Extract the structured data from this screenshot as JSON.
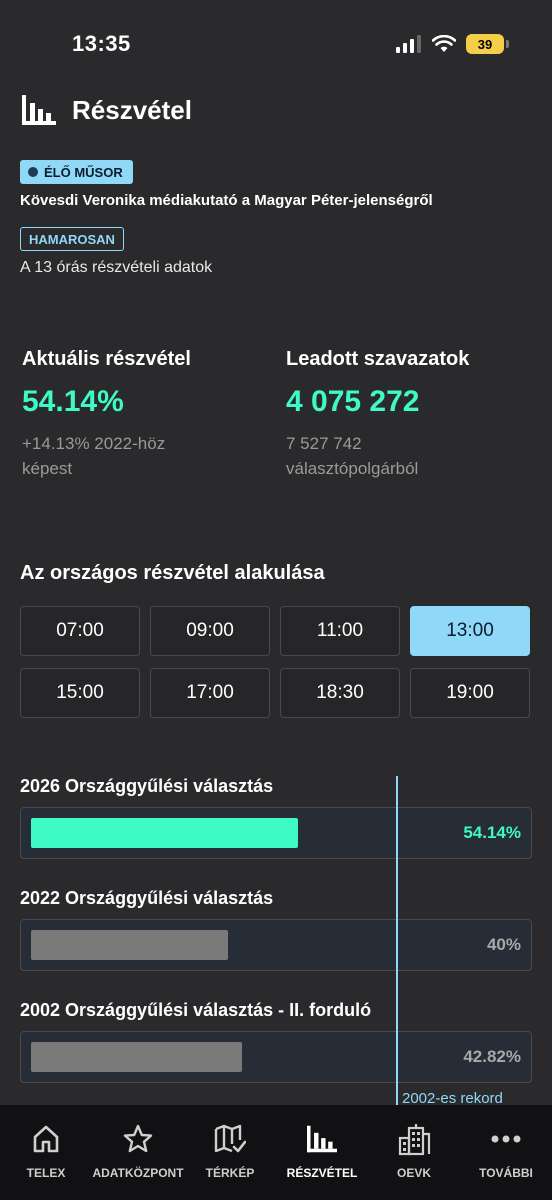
{
  "status_bar": {
    "time": "13:35",
    "battery": "39"
  },
  "header": {
    "title": "Részvétel",
    "icon": "bar-chart-icon"
  },
  "live": {
    "badge": "ÉLŐ MŰSOR",
    "title": "Kövesdi Veronika médiakutató a Magyar Péter-jelenségről",
    "soon_badge": "HAMAROSAN",
    "soon_text": "A 13 órás részvételi adatok"
  },
  "stats": {
    "turnout": {
      "label": "Aktuális részvétel",
      "value": "54.14%",
      "sub1": "+14.13% 2022-höz",
      "sub2": "képest"
    },
    "votes": {
      "label": "Leadott szavazatok",
      "value": "4 075 272",
      "sub1": "7 527 742",
      "sub2": "választópolgárból"
    }
  },
  "section_title": "Az országos részvétel alakulása",
  "times": [
    "07:00",
    "09:00",
    "11:00",
    "13:00",
    "15:00",
    "17:00",
    "18:30",
    "19:00"
  ],
  "selected_time": "13:00",
  "elections": [
    {
      "title": "2026 Országgyűlési választás",
      "value": "54.14%",
      "fraction": 0.5414,
      "color": "#3dfac6",
      "value_color": "#3dfac6"
    },
    {
      "title": "2022 Országgyűlési választás",
      "value": "40%",
      "fraction": 0.4,
      "color": "#7a7a7a",
      "value_color": "#a8a8a8"
    },
    {
      "title": "2002 Országgyűlési választás - II. forduló",
      "value": "42.82%",
      "fraction": 0.4282,
      "color": "#7a7a7a",
      "value_color": "#a8a8a8"
    }
  ],
  "record": {
    "label": "2002-es rekord",
    "fraction": 0.7418
  },
  "nav": [
    {
      "label": "TELEX",
      "icon": "home-icon"
    },
    {
      "label": "ADATKÖZPONT",
      "icon": "star-icon"
    },
    {
      "label": "TÉRKÉP",
      "icon": "map-icon"
    },
    {
      "label": "RÉSZVÉTEL",
      "icon": "bar-chart-icon",
      "active": true
    },
    {
      "label": "OEVK",
      "icon": "building-icon"
    },
    {
      "label": "TOVÁBBI",
      "icon": "more-icon"
    }
  ],
  "colors": {
    "accent": "#3dfac6",
    "highlight": "#8fd8f8",
    "background": "#2a2a2c"
  }
}
